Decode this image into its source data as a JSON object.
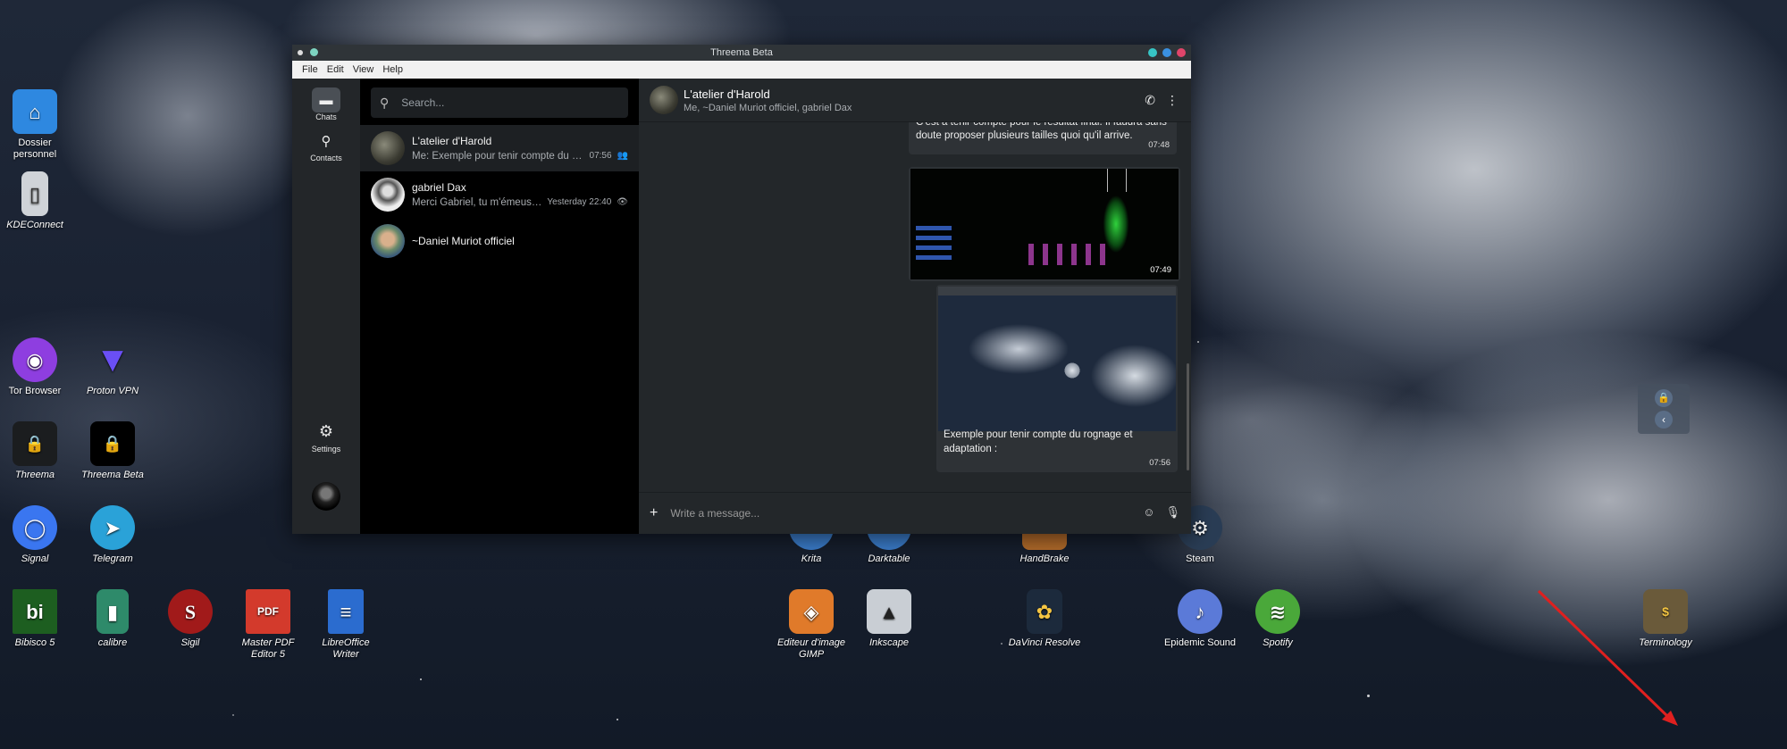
{
  "desktop": {
    "icons": [
      {
        "label": "Dossier personnel",
        "italic": false,
        "color": "#2e88e0",
        "glyph": "⌂"
      },
      {
        "label": "KDEConnect",
        "italic": true,
        "color": "#cfd3d8",
        "glyph": "▯"
      },
      {
        "label": "Tor Browser",
        "italic": false,
        "color": "#8e3ee0",
        "glyph": "◉"
      },
      {
        "label": "Proton VPN",
        "italic": true,
        "color": "#5b3ff0",
        "glyph": "▼"
      },
      {
        "label": "Threema",
        "italic": true,
        "color": "#1b1d1f",
        "glyph": "🔒"
      },
      {
        "label": "Threema Beta",
        "italic": true,
        "color": "#000000",
        "glyph": "🔒"
      },
      {
        "label": "Signal",
        "italic": true,
        "color": "#3a76f0",
        "glyph": "◯"
      },
      {
        "label": "Telegram",
        "italic": true,
        "color": "#2aa2d8",
        "glyph": "➤"
      },
      {
        "label": "Bibisco 5",
        "italic": true,
        "color": "#1d5e20",
        "glyph": "bi"
      },
      {
        "label": "calibre",
        "italic": true,
        "color": "#2e8a6a",
        "glyph": "▮"
      },
      {
        "label": "Sigil",
        "italic": true,
        "color": "#a11a1a",
        "glyph": "S"
      },
      {
        "label": "Master PDF Editor 5",
        "italic": true,
        "color": "#d33a2c",
        "glyph": "PDF"
      },
      {
        "label": "LibreOffice Writer",
        "italic": true,
        "color": "#2b6ccf",
        "glyph": "≡"
      },
      {
        "label": "Krita",
        "italic": true,
        "color": "#3a7bc8",
        "glyph": ""
      },
      {
        "label": "Darktable",
        "italic": true,
        "color": "#3a7bc8",
        "glyph": ""
      },
      {
        "label": "HandBrake",
        "italic": true,
        "color": "#b06a2a",
        "glyph": ""
      },
      {
        "label": "Steam",
        "italic": false,
        "color": "#2a3d55",
        "glyph": "⚙"
      },
      {
        "label": "Editeur d'image GIMP",
        "italic": true,
        "color": "#e07a2a",
        "glyph": "◈"
      },
      {
        "label": "Inkscape",
        "italic": true,
        "color": "#c9ced4",
        "glyph": "▲"
      },
      {
        "label": "DaVinci Resolve",
        "italic": true,
        "color": "#1c2a3c",
        "glyph": "✿"
      },
      {
        "label": "Epidemic Sound",
        "italic": false,
        "color": "#5b7ad8",
        "glyph": "♪"
      },
      {
        "label": "Spotify",
        "italic": true,
        "color": "#4aa83a",
        "glyph": "≋"
      },
      {
        "label": "Terminology",
        "italic": true,
        "color": "#6a5a3a",
        "glyph": "$"
      }
    ]
  },
  "window": {
    "title": "Threema Beta",
    "menu": [
      "File",
      "Edit",
      "View",
      "Help"
    ]
  },
  "rail": {
    "chats_label": "Chats",
    "contacts_label": "Contacts",
    "settings_label": "Settings"
  },
  "search": {
    "placeholder": "Search..."
  },
  "conversations": [
    {
      "name": "L'atelier d'Harold",
      "preview": "Me: Exemple pour tenir compte du ro...",
      "time": "07:56",
      "status": "👥"
    },
    {
      "name": "gabriel Dax",
      "preview": "Merci Gabriel, tu m'émeus c...",
      "time": "Yesterday 22:40",
      "status": "👁"
    },
    {
      "name": "~Daniel Muriot officiel",
      "preview": "",
      "time": "",
      "status": ""
    }
  ],
  "chat": {
    "title": "L'atelier d'Harold",
    "members": "Me, ~Daniel Muriot officiel, gabriel Dax",
    "messages": [
      {
        "text": "C'est à tenir compte pour le résultat final. Il faudra sans doute proposer plusieurs tailles quoi qu'il arrive.",
        "time": "07:48"
      },
      {
        "text": "",
        "time": "07:49"
      },
      {
        "text": "Exemple pour tenir compte du rognage et adaptation :",
        "time": "07:56"
      }
    ],
    "composer_placeholder": "Write a message..."
  }
}
